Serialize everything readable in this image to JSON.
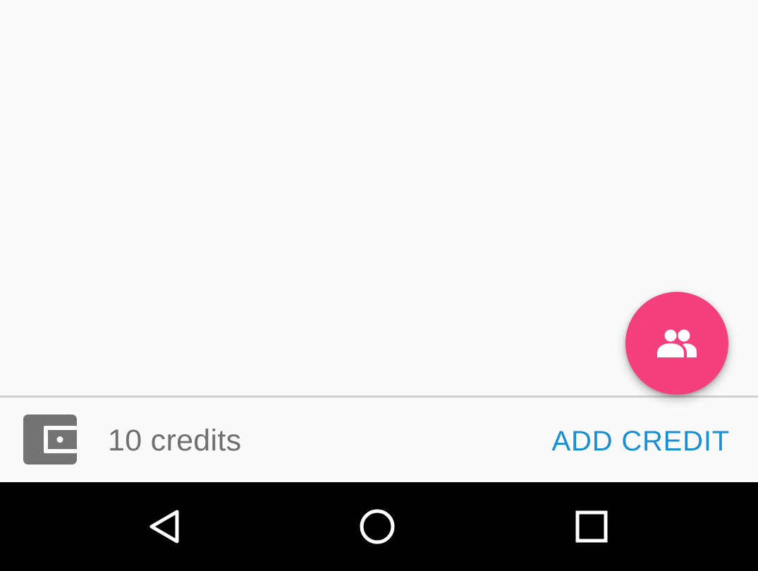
{
  "footer": {
    "credits_text": "10 credits",
    "add_credit_label": "ADD CREDIT",
    "wallet_icon": "wallet-icon"
  },
  "fab": {
    "icon": "people-icon",
    "color": "#f43f7f"
  },
  "navigation": {
    "back_icon": "back-icon",
    "home_icon": "home-icon",
    "recents_icon": "recents-icon"
  },
  "colors": {
    "accent": "#1a8fd1",
    "fab": "#f43f7f",
    "nav_bar": "#000000",
    "background": "#fafafa"
  }
}
